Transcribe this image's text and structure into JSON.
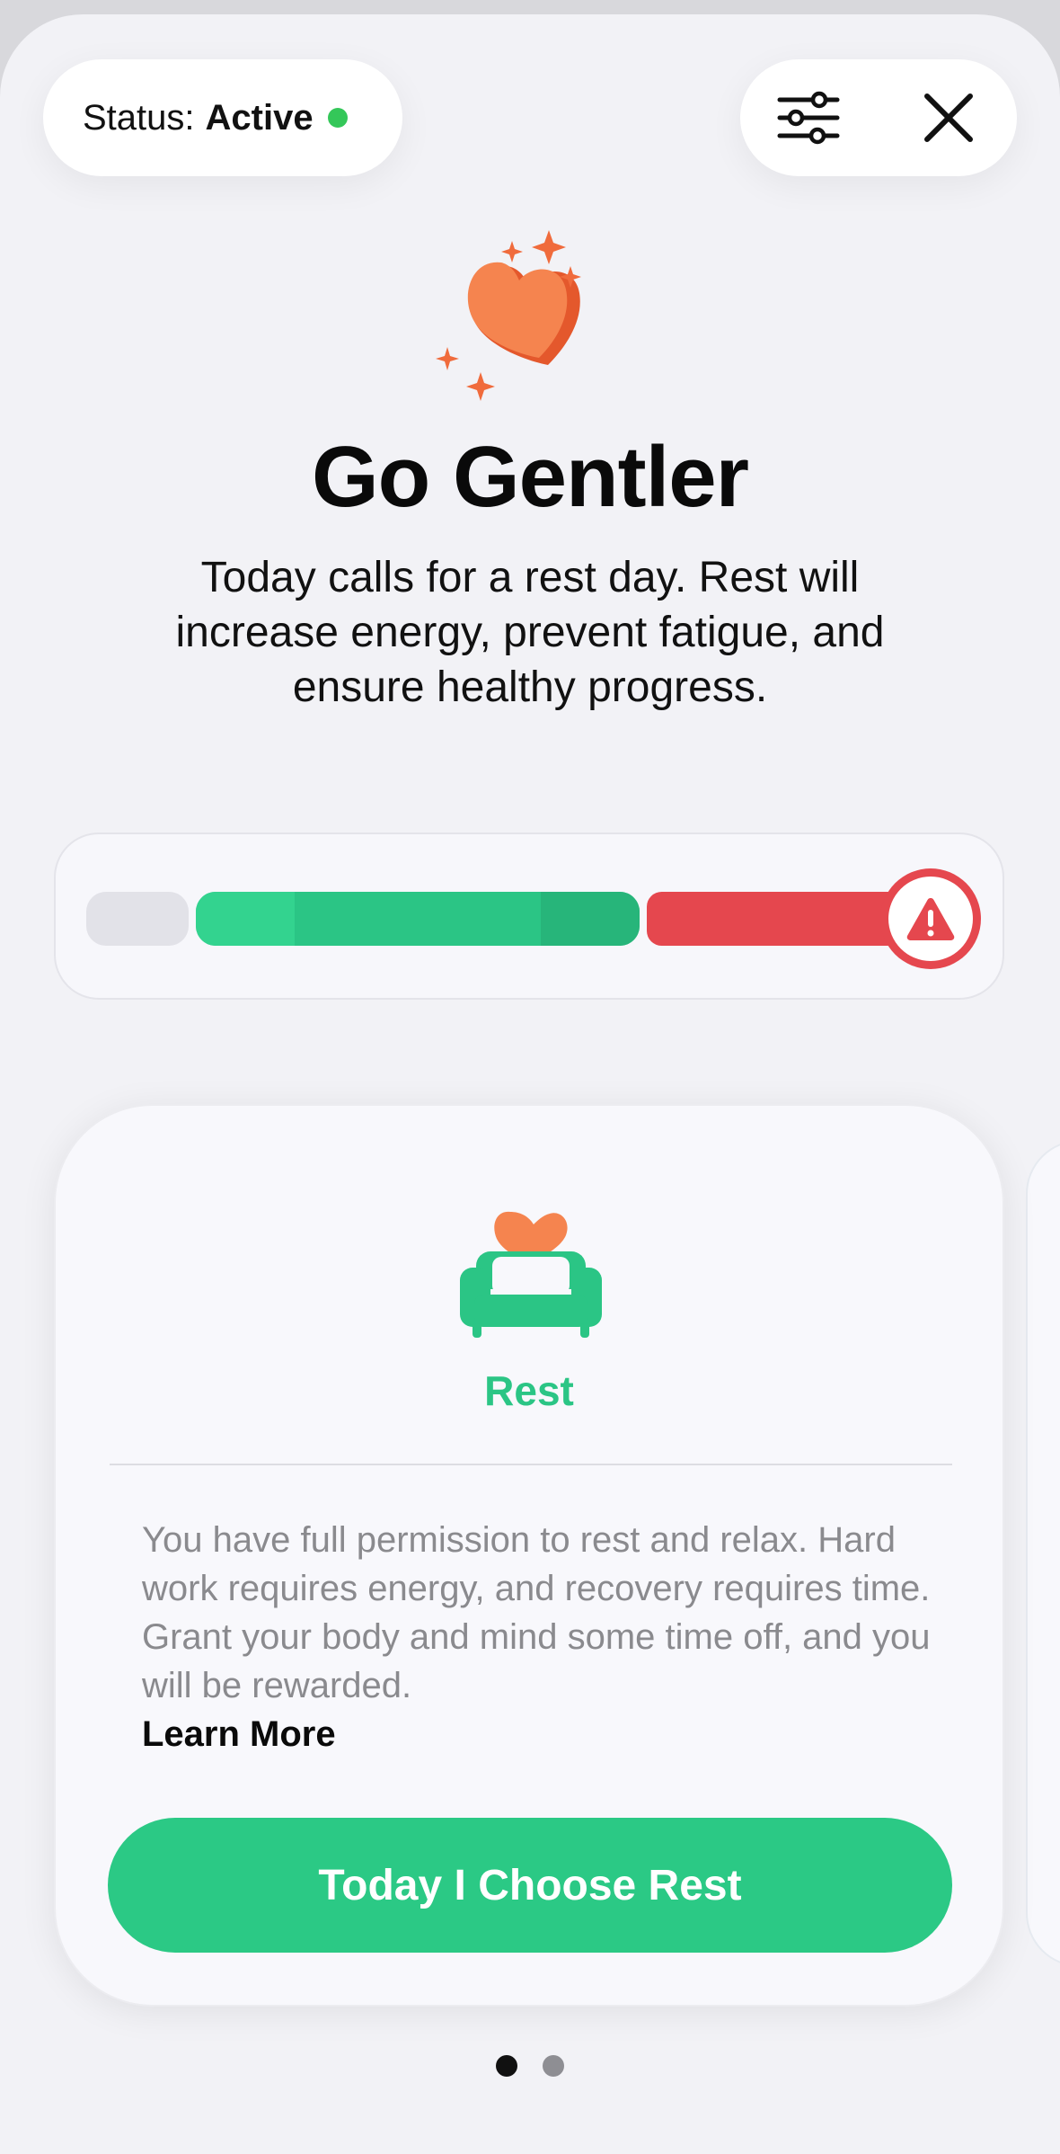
{
  "status": {
    "label": "Status:",
    "value": "Active",
    "dot_color": "#34c759"
  },
  "toolbar": {
    "filters_icon": "sliders-icon",
    "close_icon": "close-icon"
  },
  "hero": {
    "icon": "heart-sparkles-icon",
    "title": "Go Gentler",
    "subtitle": "Today calls for a rest day. Rest will increase energy, prevent fatigue, and ensure healthy progress."
  },
  "meter": {
    "segments": [
      "low",
      "optimal",
      "high"
    ],
    "current_zone": "high",
    "warning_icon": "warning-icon",
    "colors": {
      "low": "#e2e2e8",
      "optimal": "#2bc585",
      "high": "#e5474e"
    }
  },
  "card": {
    "icon": "couch-heart-icon",
    "title": "Rest",
    "body": "You have full permission to rest and relax. Hard work requires energy, and recovery requires time. Grant your body and mind some time off, and you will be rewarded.",
    "learn_more": "Learn More",
    "cta": "Today I Choose Rest",
    "accent": "#2bc585"
  },
  "pager": {
    "count": 2,
    "active": 1
  }
}
